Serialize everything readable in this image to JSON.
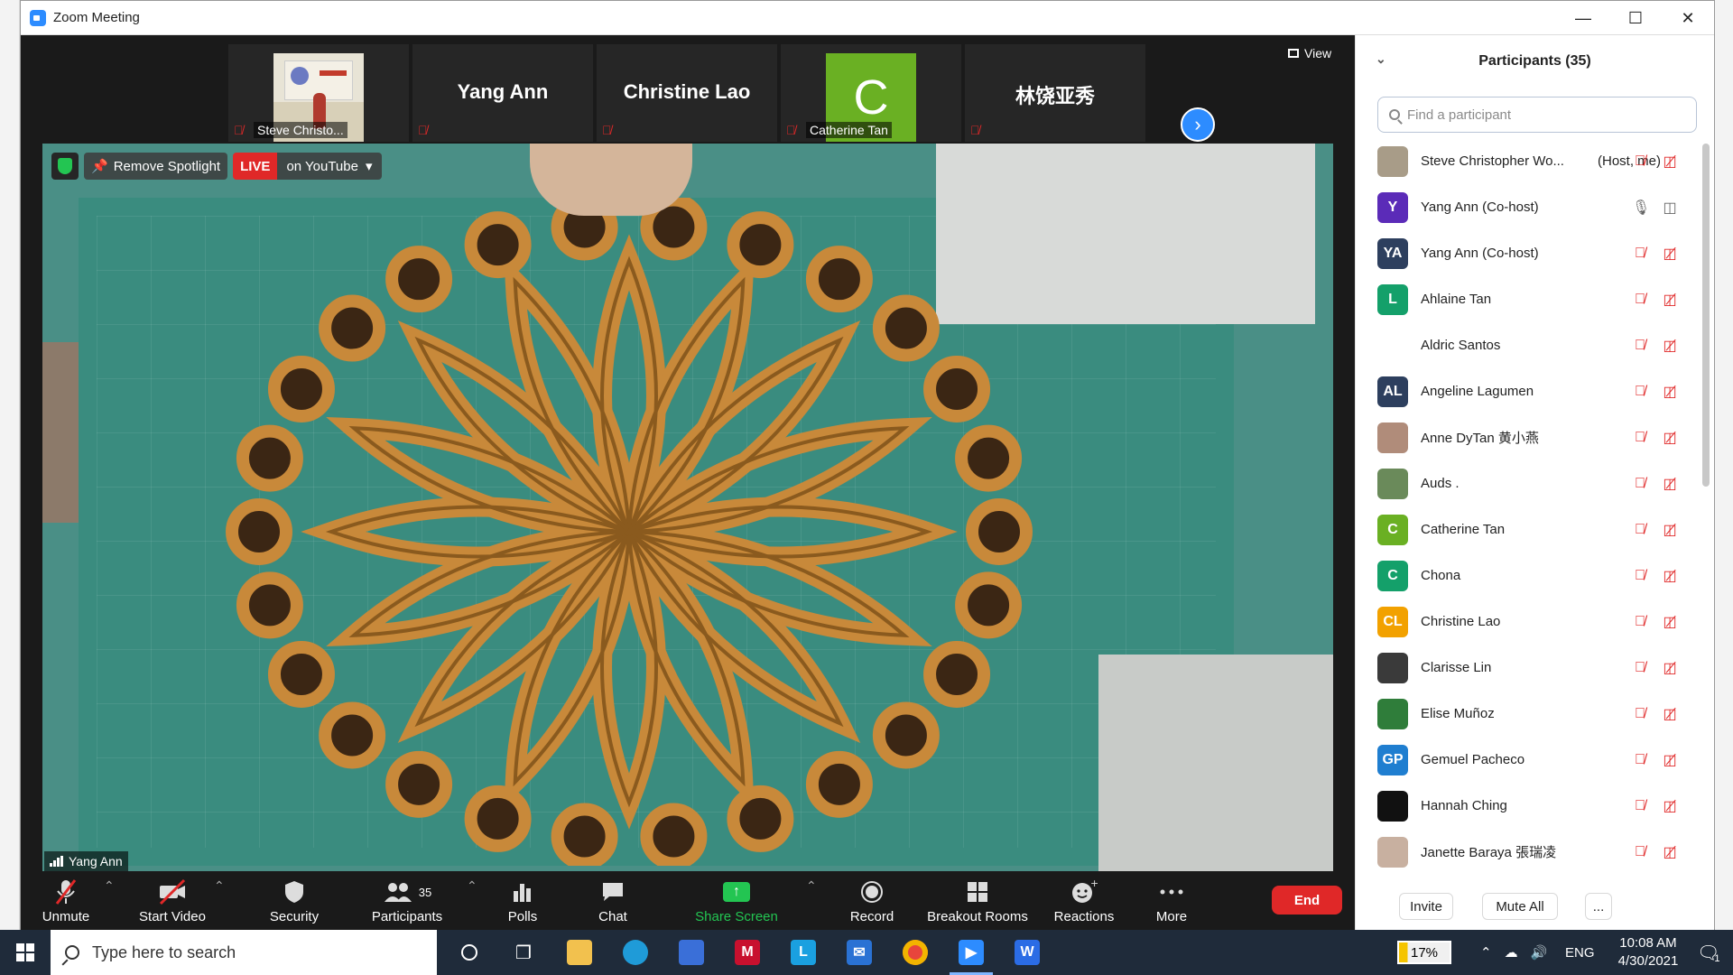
{
  "window": {
    "title": "Zoom Meeting"
  },
  "strip": {
    "tiles": [
      {
        "type": "photo",
        "name": "Steve Christo...",
        "muted": true
      },
      {
        "type": "text",
        "name": "Yang Ann",
        "muted": true
      },
      {
        "type": "text",
        "name": "Christine Lao",
        "muted": true
      },
      {
        "type": "avatar",
        "initial": "C",
        "name": "Catherine Tan",
        "muted": true,
        "color": "#6ab023"
      },
      {
        "type": "text",
        "name": "林饶亚秀",
        "muted": true
      }
    ],
    "view_label": "View"
  },
  "video": {
    "remove_spotlight": "Remove Spotlight",
    "live_label": "LIVE",
    "live_destination": "on YouTube",
    "speaker_name": "Yang Ann"
  },
  "toolbar": {
    "unmute": "Unmute",
    "start_video": "Start Video",
    "security": "Security",
    "participants": "Participants",
    "participants_count": "35",
    "polls": "Polls",
    "chat": "Chat",
    "share_screen": "Share Screen",
    "record": "Record",
    "breakout": "Breakout Rooms",
    "reactions": "Reactions",
    "more": "More",
    "end": "End"
  },
  "panel": {
    "title": "Participants (35)",
    "search_placeholder": "Find a participant",
    "participants": [
      {
        "name": "Steve Christopher Wo...",
        "role": "(Host, me)",
        "avatar": "photo",
        "color": "#a89c88",
        "mic_on": false,
        "cam_on": false
      },
      {
        "name": "Yang Ann (Co-host)",
        "role": "",
        "avatar": "Y",
        "color": "#5b2bb8",
        "mic_on": true,
        "cam_on": true
      },
      {
        "name": "Yang Ann (Co-host)",
        "role": "",
        "avatar": "YA",
        "color": "#2d3f5e",
        "mic_on": false,
        "cam_on": false
      },
      {
        "name": "Ahlaine Tan",
        "role": "",
        "avatar": "L",
        "color": "#14a06a",
        "mic_on": false,
        "cam_on": false
      },
      {
        "name": "Aldric Santos",
        "role": "",
        "avatar": "",
        "color": "",
        "mic_on": false,
        "cam_on": false
      },
      {
        "name": "Angeline Lagumen",
        "role": "",
        "avatar": "AL",
        "color": "#2d3f5e",
        "mic_on": false,
        "cam_on": false
      },
      {
        "name": "Anne DyTan 黄小燕",
        "role": "",
        "avatar": "photo",
        "color": "#b08c7a",
        "mic_on": false,
        "cam_on": false
      },
      {
        "name": "Auds .",
        "role": "",
        "avatar": "photo",
        "color": "#6a8a5a",
        "mic_on": false,
        "cam_on": false
      },
      {
        "name": "Catherine Tan",
        "role": "",
        "avatar": "C",
        "color": "#6ab023",
        "mic_on": false,
        "cam_on": false
      },
      {
        "name": "Chona",
        "role": "",
        "avatar": "C",
        "color": "#14a06a",
        "mic_on": false,
        "cam_on": false
      },
      {
        "name": "Christine Lao",
        "role": "",
        "avatar": "CL",
        "color": "#f2a100",
        "mic_on": false,
        "cam_on": false
      },
      {
        "name": "Clarisse Lin",
        "role": "",
        "avatar": "photo",
        "color": "#3a3a3a",
        "mic_on": false,
        "cam_on": false
      },
      {
        "name": "Elise Muñoz",
        "role": "",
        "avatar": "photo",
        "color": "#2f7d3a",
        "mic_on": false,
        "cam_on": false
      },
      {
        "name": "Gemuel Pacheco",
        "role": "",
        "avatar": "GP",
        "color": "#1f7ed0",
        "mic_on": false,
        "cam_on": false
      },
      {
        "name": "Hannah Ching",
        "role": "",
        "avatar": "photo",
        "color": "#111111",
        "mic_on": false,
        "cam_on": false
      },
      {
        "name": "Janette Baraya 張瑞凌",
        "role": "",
        "avatar": "photo",
        "color": "#c8b0a0",
        "mic_on": false,
        "cam_on": false
      }
    ],
    "invite": "Invite",
    "mute_all": "Mute All",
    "more": "..."
  },
  "taskbar": {
    "search_placeholder": "Type here to search",
    "battery": "17%",
    "language": "ENG",
    "time": "10:08 AM",
    "date": "4/30/2021",
    "notification_count": "1"
  }
}
